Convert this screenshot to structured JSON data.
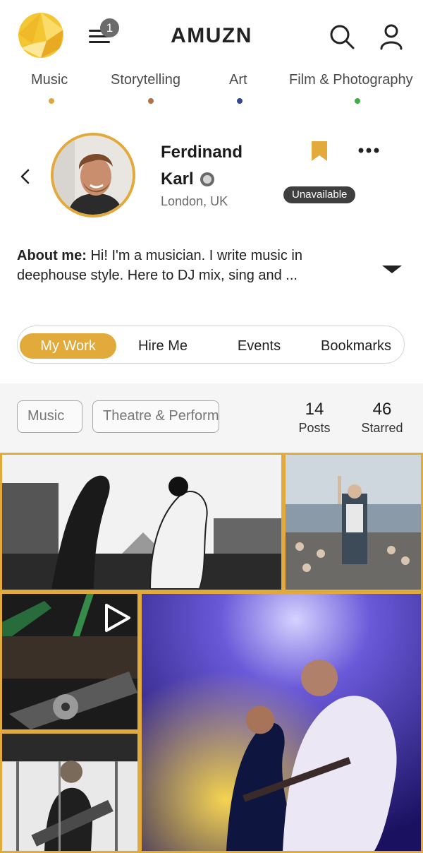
{
  "header": {
    "brand": "AMUZN",
    "notification_count": "1",
    "icons": [
      "logo-icon",
      "menu-icon",
      "search-icon",
      "user-icon"
    ]
  },
  "categories": [
    {
      "label": "Music",
      "color": "#d9a83f"
    },
    {
      "label": "Storytelling",
      "color": "#b0714a"
    },
    {
      "label": "Art",
      "color": "#2f4a8f"
    },
    {
      "label": "Film & Photography",
      "color": "#3fae49"
    }
  ],
  "profile": {
    "first_name": "Ferdinand",
    "last_name": "Karl",
    "location": "London, UK",
    "status": "Unavailable",
    "about_label": "About me:",
    "about_text": "Hi! I'm a musician. I write music in deephouse style. Here to DJ mix, sing and ..."
  },
  "tabs": [
    {
      "label": "My Work",
      "active": true
    },
    {
      "label": "Hire Me",
      "active": false
    },
    {
      "label": "Events",
      "active": false
    },
    {
      "label": "Bookmarks",
      "active": false
    }
  ],
  "filters": {
    "chips": [
      "Music",
      "Theatre & Performance"
    ],
    "posts_count": "14",
    "posts_label": "Posts",
    "starred_count": "46",
    "starred_label": "Starred"
  },
  "colors": {
    "accent": "#e2a93b",
    "status_bg": "#3f3f3f"
  }
}
